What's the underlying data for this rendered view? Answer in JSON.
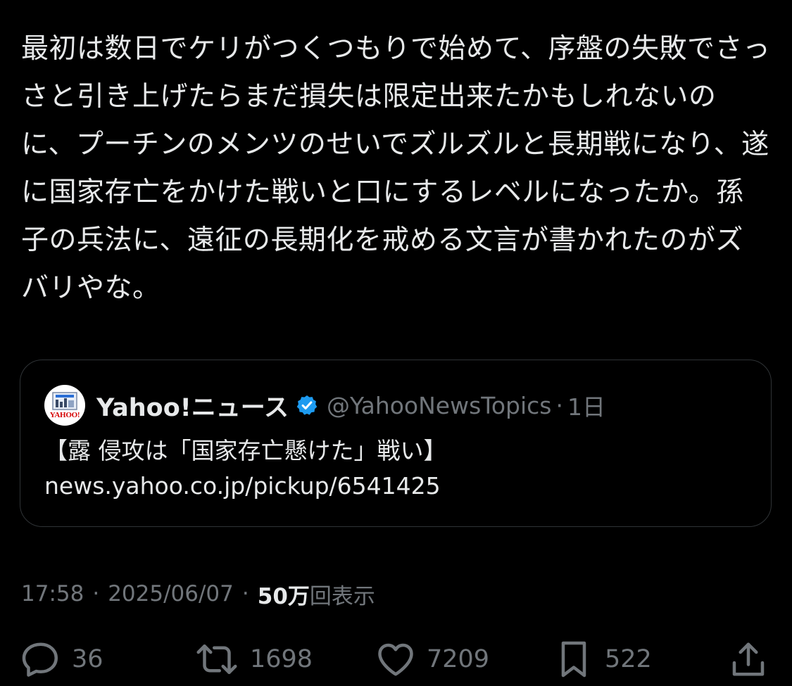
{
  "tweet": {
    "text": "最初は数日でケリがつくつもりで始めて、序盤の失敗でさっさと引き上げたらまだ損失は限定出来たかもしれないのに、プーチンのメンツのせいでズルズルと長期戦になり、遂に国家存亡をかけた戦いと口にするレベルになったか。孫子の兵法に、遠征の長期化を戒める文言が書かれたのがズバリやな。"
  },
  "quote": {
    "avatar_logo": "YAHOO!",
    "name": "Yahoo!ニュース",
    "handle": "@YahooNewsTopics",
    "separator": "·",
    "time": "1日",
    "line1": "【露 侵攻は「国家存亡懸けた」戦い】",
    "line2": "news.yahoo.co.jp/pickup/6541425"
  },
  "meta": {
    "time": "17:58",
    "dot": "·",
    "date": "2025/06/07",
    "views_count": "50万",
    "views_label": "回表示"
  },
  "actions": {
    "replies": "36",
    "reposts": "1698",
    "likes": "7209",
    "bookmarks": "522"
  },
  "colors": {
    "background": "#000000",
    "text": "#e7e9ea",
    "secondary": "#71767b",
    "border": "#2f3336",
    "verified": "#1d9bf0"
  }
}
